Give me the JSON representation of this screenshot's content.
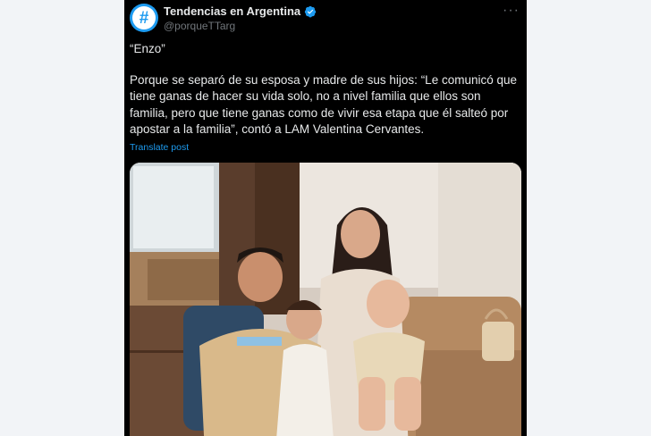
{
  "tweet": {
    "author_name": "Tendencias en Argentina",
    "author_handle": "@porqueTTarg",
    "avatar_glyph": "#",
    "quote": "“Enzo”",
    "text": "Porque se separó de su esposa y madre de sus hijos: “Le comunicó que tiene ganas de hacer su vida solo, no a nivel familia que ellos son familia, pero que tiene ganas como de vivir esa etapa que él salteó por apostar a la familia”, contó a LAM Valentina Cervantes.",
    "translate_label": "Translate post",
    "more_glyph": "···"
  },
  "colors": {
    "background": "#f2f4f7",
    "card": "#000000",
    "text": "#e7e9ea",
    "muted": "#71767b",
    "accent": "#1d9bf0"
  },
  "icons": {
    "verified": "verified-badge-icon",
    "more": "more-options-icon"
  }
}
